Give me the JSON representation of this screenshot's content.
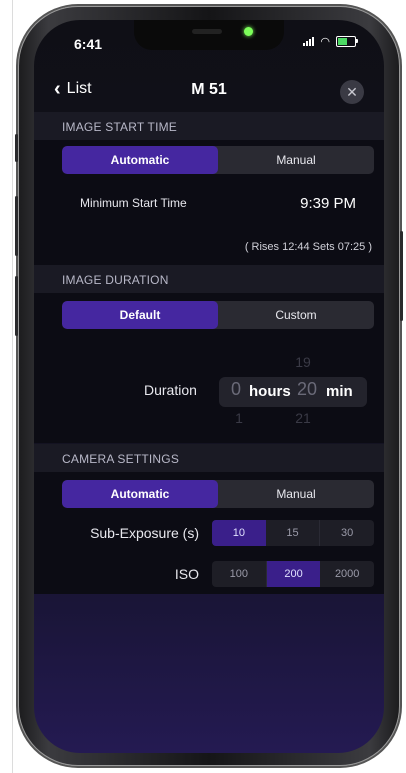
{
  "status_bar": {
    "time": "6:41"
  },
  "nav": {
    "back_label": "List",
    "title": "M 51"
  },
  "image_start_time": {
    "header": "IMAGE START TIME",
    "options": [
      "Automatic",
      "Manual"
    ],
    "selected": "Automatic",
    "min_start_label": "Minimum Start Time",
    "min_start_value": "9:39 PM",
    "rise_set_note": "( Rises 12:44  Sets 07:25 )"
  },
  "image_duration": {
    "header": "IMAGE DURATION",
    "options": [
      "Default",
      "Custom"
    ],
    "selected": "Default",
    "duration_label": "Duration",
    "hours_value": "0",
    "hours_unit": "hours",
    "minutes_value": "20",
    "minutes_unit": "min",
    "minutes_prev": "19",
    "minutes_next": "21",
    "hours_next": "1"
  },
  "camera_settings": {
    "header": "CAMERA SETTINGS",
    "options": [
      "Automatic",
      "Manual"
    ],
    "selected": "Automatic",
    "sub_exposure_label": "Sub-Exposure (s)",
    "sub_exposure_options": [
      "10",
      "15",
      "30"
    ],
    "sub_exposure_selected": "10",
    "iso_label": "ISO",
    "iso_options": [
      "100",
      "200",
      "2000"
    ],
    "iso_selected": "200"
  },
  "colors": {
    "accent": "#4527a0",
    "background": "#0c0c14",
    "camera_dot": "#7dff5a"
  },
  "icons": {
    "back": "chevron-left-icon",
    "close": "close-icon",
    "signal": "signal-icon",
    "wifi": "wifi-icon",
    "battery": "battery-icon"
  }
}
